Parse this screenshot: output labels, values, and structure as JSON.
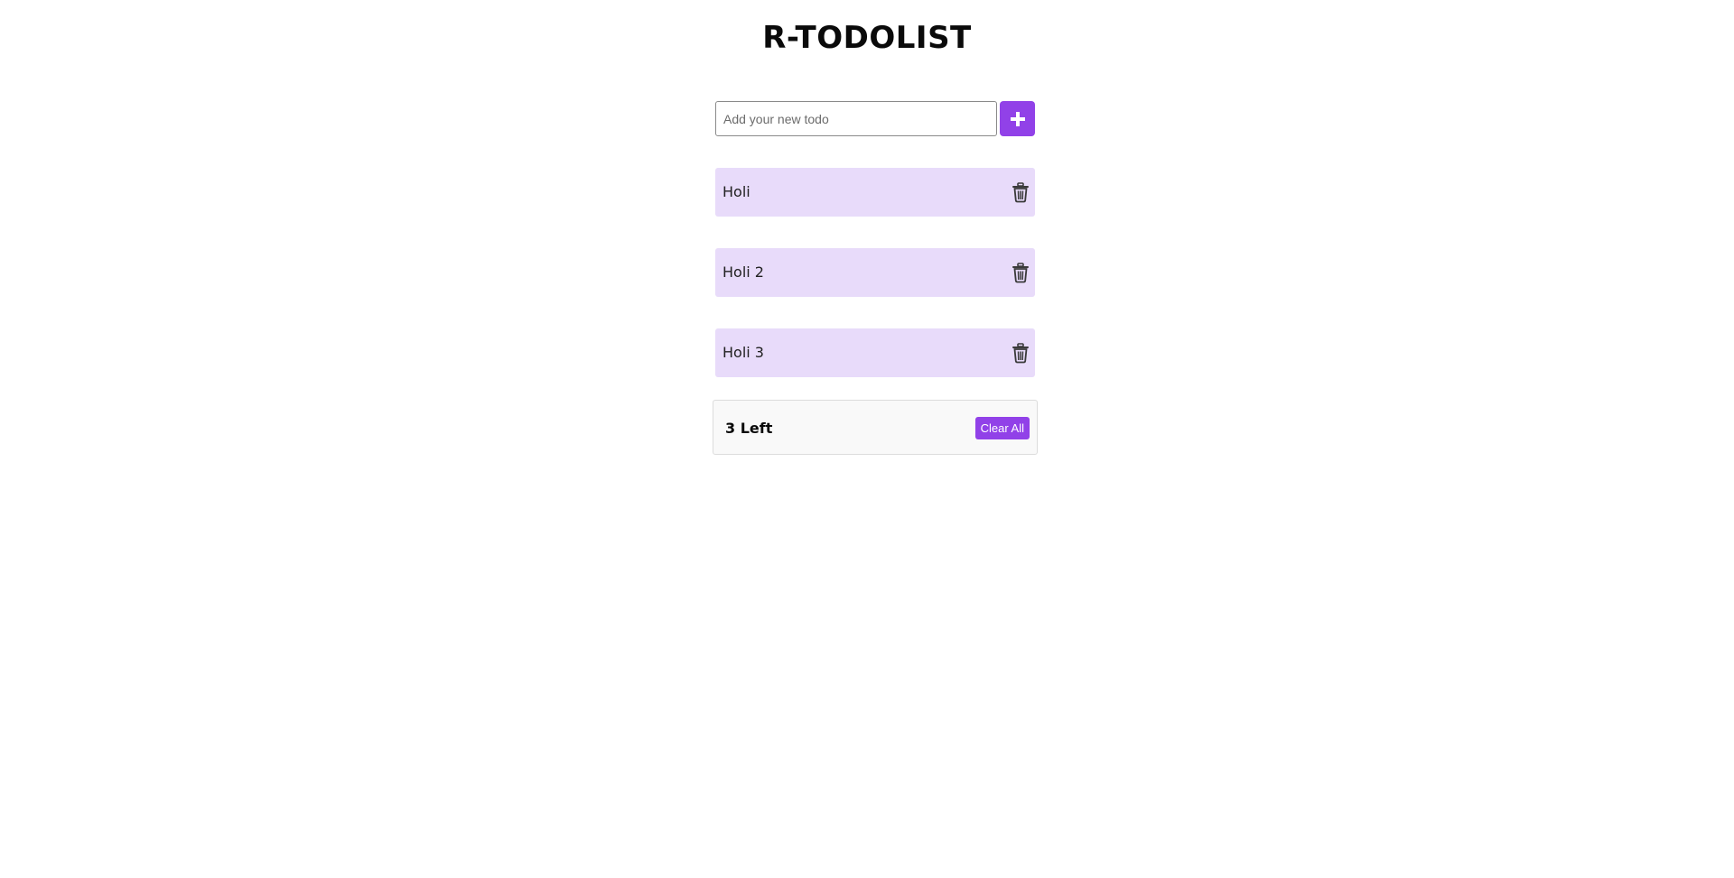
{
  "app": {
    "title": "R-TODOLIST",
    "accent_color": "#9141e8",
    "item_bg_color": "#e8dbfa"
  },
  "add_form": {
    "input_value": "",
    "placeholder": "Add your new todo",
    "add_icon": "plus-icon"
  },
  "todos": [
    {
      "text": "Holi",
      "icon": "trash-icon"
    },
    {
      "text": "Holi 2",
      "icon": "trash-icon"
    },
    {
      "text": "Holi 3",
      "icon": "trash-icon"
    }
  ],
  "footer": {
    "left_count_label": "3 Left",
    "clear_label": "Clear All"
  }
}
